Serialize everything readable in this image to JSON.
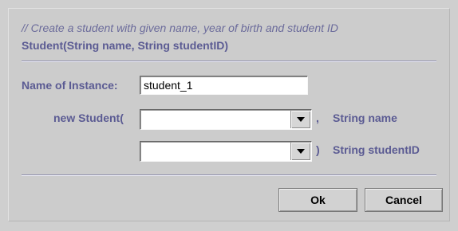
{
  "dialog": {
    "comment": "// Create a student with given name, year of birth and student ID",
    "signature": "Student(String name, String studentID)"
  },
  "form": {
    "instance_label": "Name of Instance:",
    "instance_value": "student_1",
    "constructor_label": "new Student(",
    "param1": {
      "value": "",
      "separator": ",",
      "type_label": "String name"
    },
    "param2": {
      "value": "",
      "separator": ")",
      "type_label": "String studentID"
    }
  },
  "buttons": {
    "ok_label": "Ok",
    "cancel_label": "Cancel"
  },
  "icons": {
    "dropdown": "chevron-down-icon"
  }
}
